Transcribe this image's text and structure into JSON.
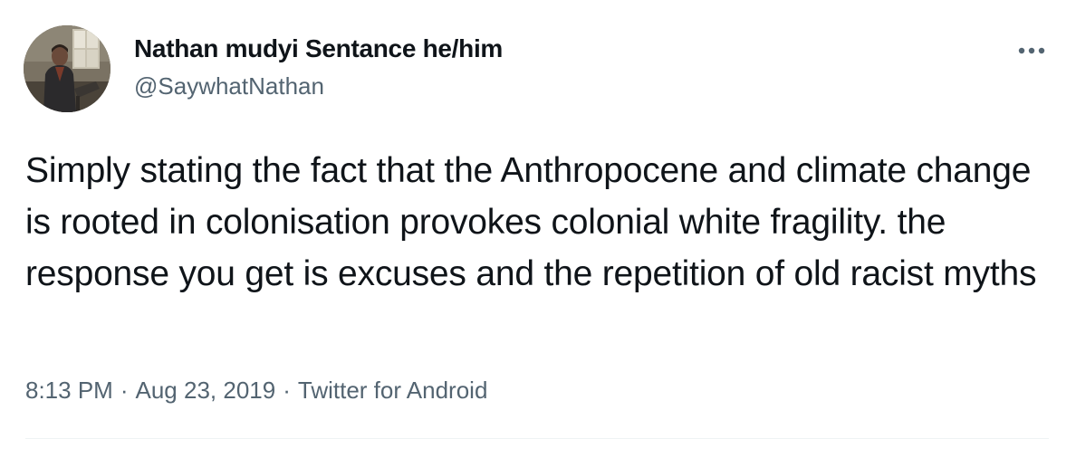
{
  "tweet": {
    "author": {
      "display_name": "Nathan mudyi Sentance he/him",
      "handle": "@SaywhatNathan",
      "avatar_icon": "person-photo-avatar"
    },
    "text": "Simply stating the fact that the Anthropocene and climate change is rooted in colonisation provokes colonial white fragility. the response you get is excuses and the repetition of old racist myths",
    "time": "8:13 PM",
    "date": "Aug 23, 2019",
    "source": "Twitter for Android",
    "separator": "·",
    "more_icon": "more-horizontal-icon"
  },
  "colors": {
    "text_primary": "#0f1419",
    "text_secondary": "#536471",
    "divider": "#eff3f4",
    "background": "#ffffff"
  }
}
